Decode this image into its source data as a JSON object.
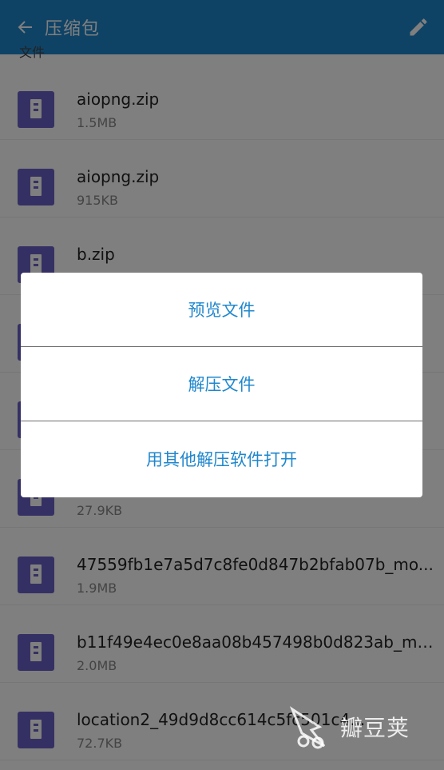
{
  "header": {
    "title": "压缩包",
    "back_icon": "arrow-back-icon",
    "edit_icon": "pencil-icon"
  },
  "section_header": "文件",
  "files": [
    {
      "name": "aiopng.zip",
      "size": "1.5MB"
    },
    {
      "name": "aiopng.zip",
      "size": "915KB"
    },
    {
      "name": "b.zip",
      "size": ""
    },
    {
      "name": "",
      "size": ""
    },
    {
      "name": "",
      "size": ""
    },
    {
      "name": "",
      "size": "27.9KB"
    },
    {
      "name": "47559fb1e7a5d7c8fe0d847b2bfab07b_mo...",
      "size": "1.9MB"
    },
    {
      "name": "b11f49e4ec0e8aa08b457498b0d823ab_mo...",
      "size": "2.0MB"
    },
    {
      "name": "location2_49d9d8cc614c5fc501c4...",
      "size": "72.7KB"
    }
  ],
  "dialog": {
    "items": [
      "预览文件",
      "解压文件",
      "用其他解压软件打开"
    ]
  },
  "watermark": {
    "text": "瓣豆荚"
  },
  "colors": {
    "appbar": "#1f87cd",
    "zip_icon": "#6a61c7",
    "dialog_text": "#1f87cd"
  }
}
